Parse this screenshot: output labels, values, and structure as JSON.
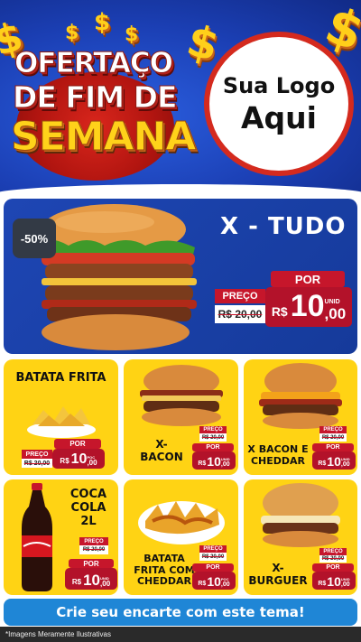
{
  "header": {
    "title_line1": "OFERTAÇO",
    "title_line2": "DE FIM DE",
    "title_line3": "SEMANA",
    "dollar_symbol": "$",
    "logo_line1": "Sua Logo",
    "logo_line2": "Aqui"
  },
  "featured": {
    "discount": "-50%",
    "name": "X - TUDO",
    "por_label": "POR",
    "old_label": "PREÇO",
    "old_price": "R$ 20,00",
    "currency": "R$",
    "price_int": "10",
    "price_dec": ",00",
    "unit": "UNID"
  },
  "products": [
    {
      "name": "BATATA FRITA",
      "old_label": "PREÇO",
      "old_price": "R$ 20,00",
      "por_label": "POR",
      "currency": "R$",
      "price_int": "10",
      "price_dec": ",00",
      "unit": "POC"
    },
    {
      "name": "X-\nBACON",
      "old_label": "PREÇO",
      "old_price": "R$ 20,00",
      "por_label": "POR",
      "currency": "R$",
      "price_int": "10",
      "price_dec": ",00",
      "unit": "UNID"
    },
    {
      "name": "X BACON E\nCHEDDAR",
      "old_label": "PREÇO",
      "old_price": "R$ 20,00",
      "por_label": "POR",
      "currency": "R$",
      "price_int": "10",
      "price_dec": ",00",
      "unit": "UNID"
    },
    {
      "name": "COCA\nCOLA\n2L",
      "old_label": "PREÇO",
      "old_price": "R$ 20,00",
      "por_label": "POR",
      "currency": "R$",
      "price_int": "10",
      "price_dec": ",00",
      "unit": "UNID"
    },
    {
      "name": "BATATA\nFRITA COM\nCHEDDAR",
      "old_label": "PREÇO",
      "old_price": "R$ 20,00",
      "por_label": "POR",
      "currency": "R$",
      "price_int": "10",
      "price_dec": ",00",
      "unit": "POC"
    },
    {
      "name": "X-\nBURGUER",
      "old_label": "PREÇO",
      "old_price": "R$ 20,00",
      "por_label": "POR",
      "currency": "R$",
      "price_int": "10",
      "price_dec": ",00",
      "unit": "UNID"
    }
  ],
  "footer": {
    "cta": "Crie seu encarte com este tema!",
    "disclaimer": "*Imagens Meramente Ilustrativas"
  },
  "colors": {
    "header_blue": "#1b3fb4",
    "accent_red": "#c6162b",
    "card_yellow": "#ffd314",
    "cta_blue": "#1f86d6"
  }
}
